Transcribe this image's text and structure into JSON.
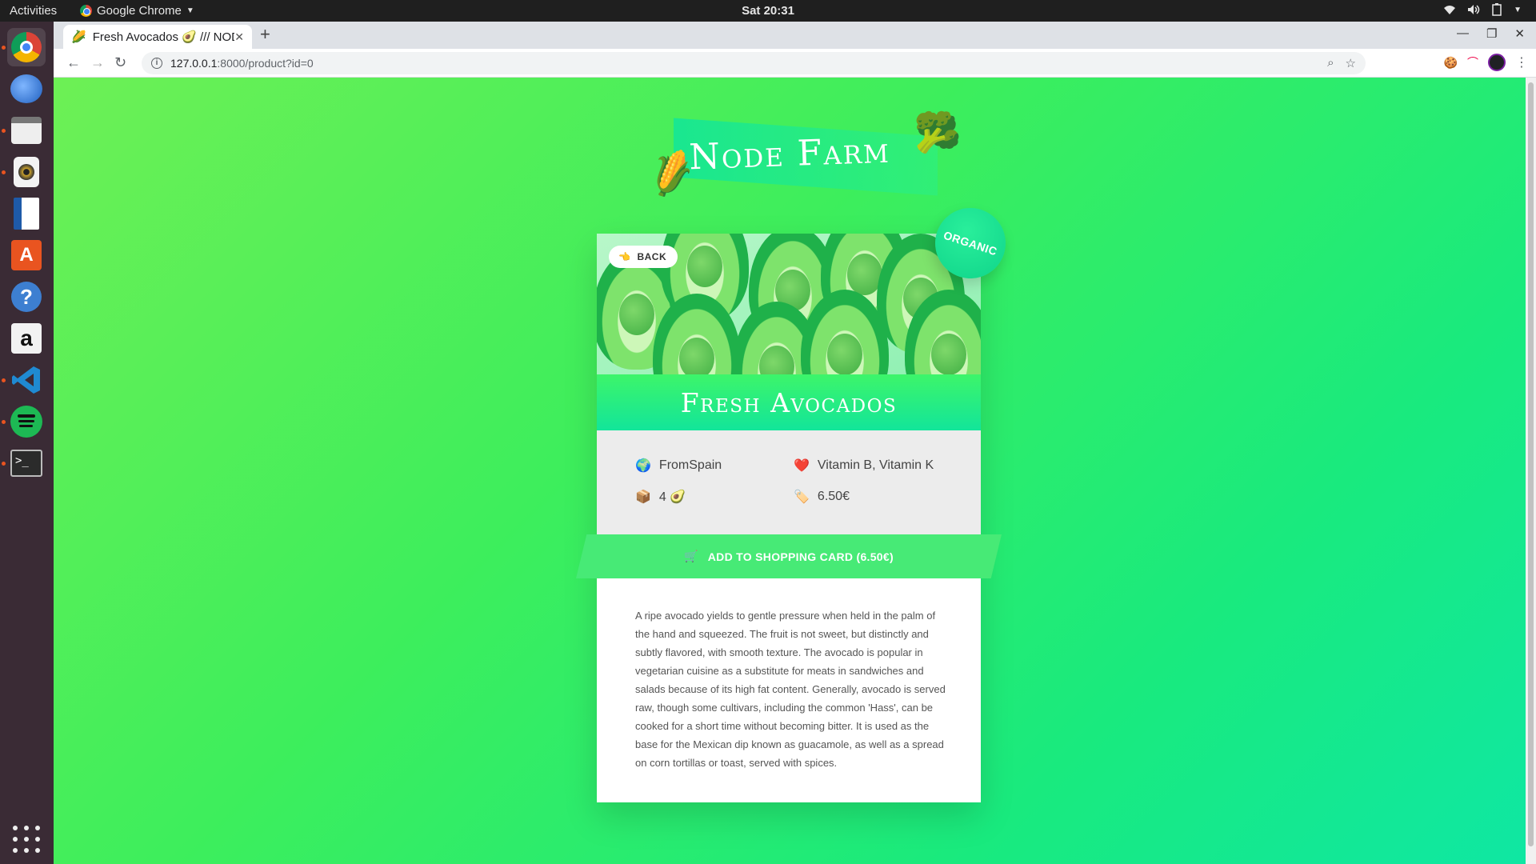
{
  "system_bar": {
    "activities": "Activities",
    "app_name": "Google Chrome",
    "clock": "Sat 20:31"
  },
  "browser": {
    "tab_title": "Fresh Avocados 🥑 /// NODE FARM",
    "tab_icon": "🌽",
    "new_tab": "+",
    "url_host": "127.0.0.1",
    "url_path": ":8000/product?id=0"
  },
  "page": {
    "logo_text": "Node Farm",
    "logo_left_emoji": "🌽",
    "logo_right_emoji": "🥦",
    "back_label": "BACK",
    "back_emoji": "👈",
    "organic_badge": "ORGANIC",
    "product_name": "Fresh Avocados",
    "details": {
      "from_emoji": "🌍",
      "from": "FromSpain",
      "nutrients_emoji": "❤️",
      "nutrients": "Vitamin B, Vitamin K",
      "quantity_emoji": "📦",
      "quantity": "4 🥑",
      "price_emoji": "🏷️",
      "price": "6.50€"
    },
    "cta_emoji": "🛒",
    "cta_label": "ADD TO SHOPPING CARD (6.50€)",
    "description": "A ripe avocado yields to gentle pressure when held in the palm of the hand and squeezed. The fruit is not sweet, but distinctly and subtly flavored, with smooth texture. The avocado is popular in vegetarian cuisine as a substitute for meats in sandwiches and salads because of its high fat content. Generally, avocado is served raw, though some cultivars, including the common 'Hass', can be cooked for a short time without becoming bitter. It is used as the base for the Mexican dip known as guacamole, as well as a spread on corn tortillas or toast, served with spices."
  },
  "colors": {
    "brand_green": "#47ea76",
    "teal": "#12e59a",
    "dock_bg": "#3a2b35"
  },
  "dock_apps": [
    "chrome-icon",
    "thunderbird-icon",
    "files-icon",
    "rhythmbox-icon",
    "writer-icon",
    "software-icon",
    "help-icon",
    "amazon-icon",
    "vscode-icon",
    "spotify-icon",
    "terminal-icon"
  ]
}
